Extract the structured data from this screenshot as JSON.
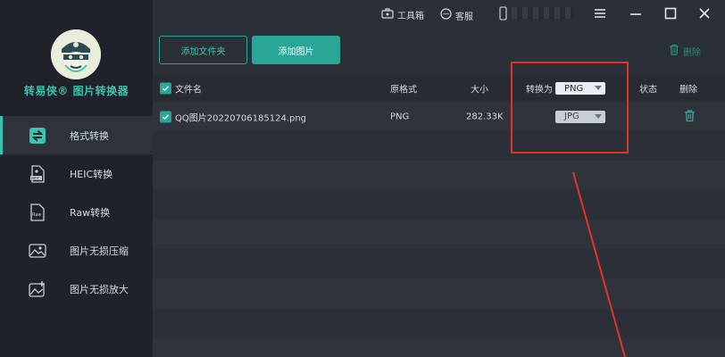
{
  "sidebar": {
    "brand": "转易侠® 图片转换器",
    "items": [
      {
        "label": "格式转换",
        "icon": "format-convert-icon",
        "active": true
      },
      {
        "label": "HEIC转换",
        "icon": "heic-file-icon",
        "active": false
      },
      {
        "label": "Raw转换",
        "icon": "raw-file-icon",
        "active": false
      },
      {
        "label": "图片无损压缩",
        "icon": "image-compress-icon",
        "active": false
      },
      {
        "label": "图片无损放大",
        "icon": "image-enlarge-icon",
        "active": false
      }
    ]
  },
  "topbar": {
    "toolbox": "工具箱",
    "service": "客服"
  },
  "toolbar": {
    "add_folder": "添加文件夹",
    "add_image": "添加图片",
    "delete": "删除"
  },
  "table": {
    "headers": {
      "filename": "文件名",
      "original_format": "原格式",
      "size": "大小",
      "convert_to": "转换为",
      "convert_to_value": "PNG",
      "status": "状态",
      "delete": "删除"
    },
    "rows": [
      {
        "filename": "QQ图片20220706185124.png",
        "format": "PNG",
        "size": "282.33K",
        "target": "JPG"
      }
    ]
  },
  "colors": {
    "accent": "#2aa697",
    "annotation": "#e0342b"
  }
}
